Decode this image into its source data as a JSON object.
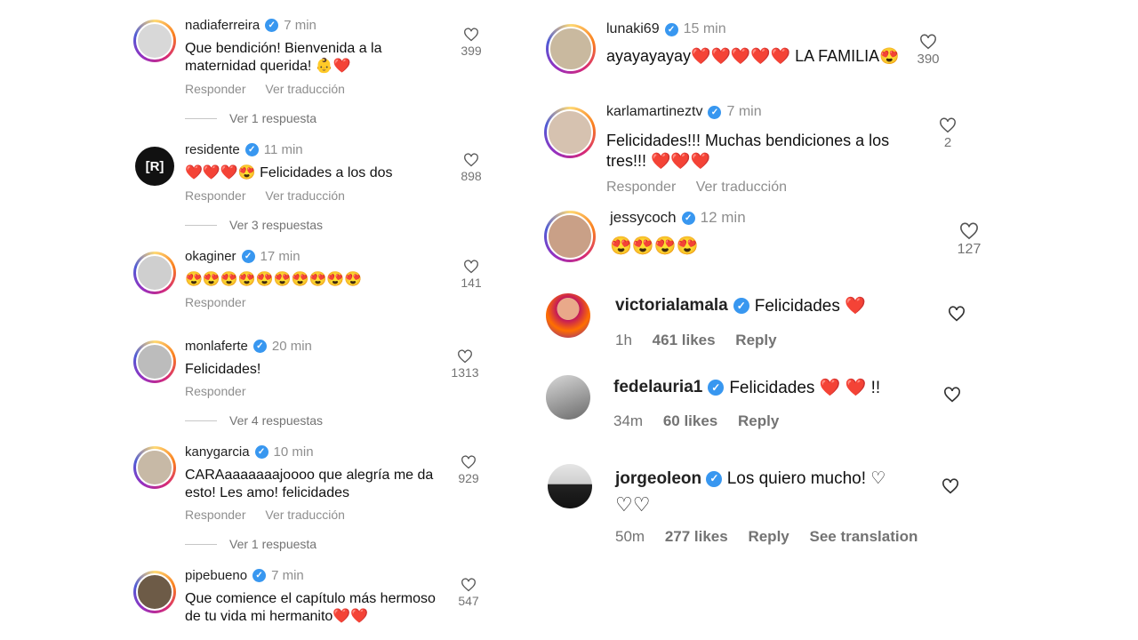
{
  "left": {
    "comments": [
      {
        "user": "nadiaferreira",
        "time": "7 min",
        "text1": "Que bendición! Bienvenida a la",
        "text2": "maternidad querida! 👶❤️",
        "reply": "Responder",
        "translate": "Ver traducción",
        "likes": "399",
        "more": "Ver 1 respuesta"
      },
      {
        "user": "residente",
        "time": "11 min",
        "text1": "❤️❤️❤️😍 Felicidades a los dos",
        "reply": "Responder",
        "translate": "Ver traducción",
        "likes": "898",
        "more": "Ver 3 respuestas",
        "logo": "[R]"
      },
      {
        "user": "okaginer",
        "time": "17 min",
        "text1": "😍😍😍😍😍😍😍😍😍😍",
        "reply": "Responder",
        "likes": "141"
      },
      {
        "user": "monlaferte",
        "time": "20 min",
        "text1": "Felicidades!",
        "reply": "Responder",
        "likes": "1313",
        "more": "Ver 4 respuestas"
      },
      {
        "user": "kanygarcia",
        "time": "10 min",
        "text1": "CARAaaaaaaajoooo que alegría me da",
        "text2": "esto! Les amo! felicidades",
        "reply": "Responder",
        "translate": "Ver traducción",
        "likes": "929",
        "more": "Ver 1 respuesta"
      },
      {
        "user": "pipebueno",
        "time": "7 min",
        "text1": "Que comience el capítulo más hermoso",
        "text2": "de tu vida mi hermanito❤️❤️",
        "likes": "547"
      }
    ]
  },
  "right": {
    "c1": {
      "user": "lunaki69",
      "time": "15 min",
      "text1": "ayayayayay❤️❤️❤️❤️❤️ LA FAMILIA😍",
      "likes": "390"
    },
    "c2": {
      "user": "karlamartineztv",
      "time": "7 min",
      "text1": "Felicidades!!! Muchas bendiciones a los",
      "text2": "tres!!! ❤️❤️❤️",
      "reply": "Responder",
      "translate": "Ver traducción",
      "likes": "2"
    },
    "c3": {
      "user": "jessycoch",
      "time": "12 min",
      "text1": "😍😍😍😍",
      "likes": "127"
    },
    "c4": {
      "user": "victorialamala",
      "text": "Felicidades ❤️",
      "time": "1h",
      "likes": "461 likes",
      "reply": "Reply"
    },
    "c5": {
      "user": "fedelauria1",
      "text": "Felicidades ❤️ ❤️ !!",
      "time": "34m",
      "likes": "60 likes",
      "reply": "Reply"
    },
    "c6": {
      "user": "jorgeoleon",
      "text1": "Los quiero mucho! ♡",
      "text2": "♡♡",
      "time": "50m",
      "likes": "277 likes",
      "reply": "Reply",
      "translate": "See translation"
    }
  },
  "colors": {
    "verified": "#3897f0",
    "muted": "#8e8e8e",
    "heart": "#e0102e"
  }
}
